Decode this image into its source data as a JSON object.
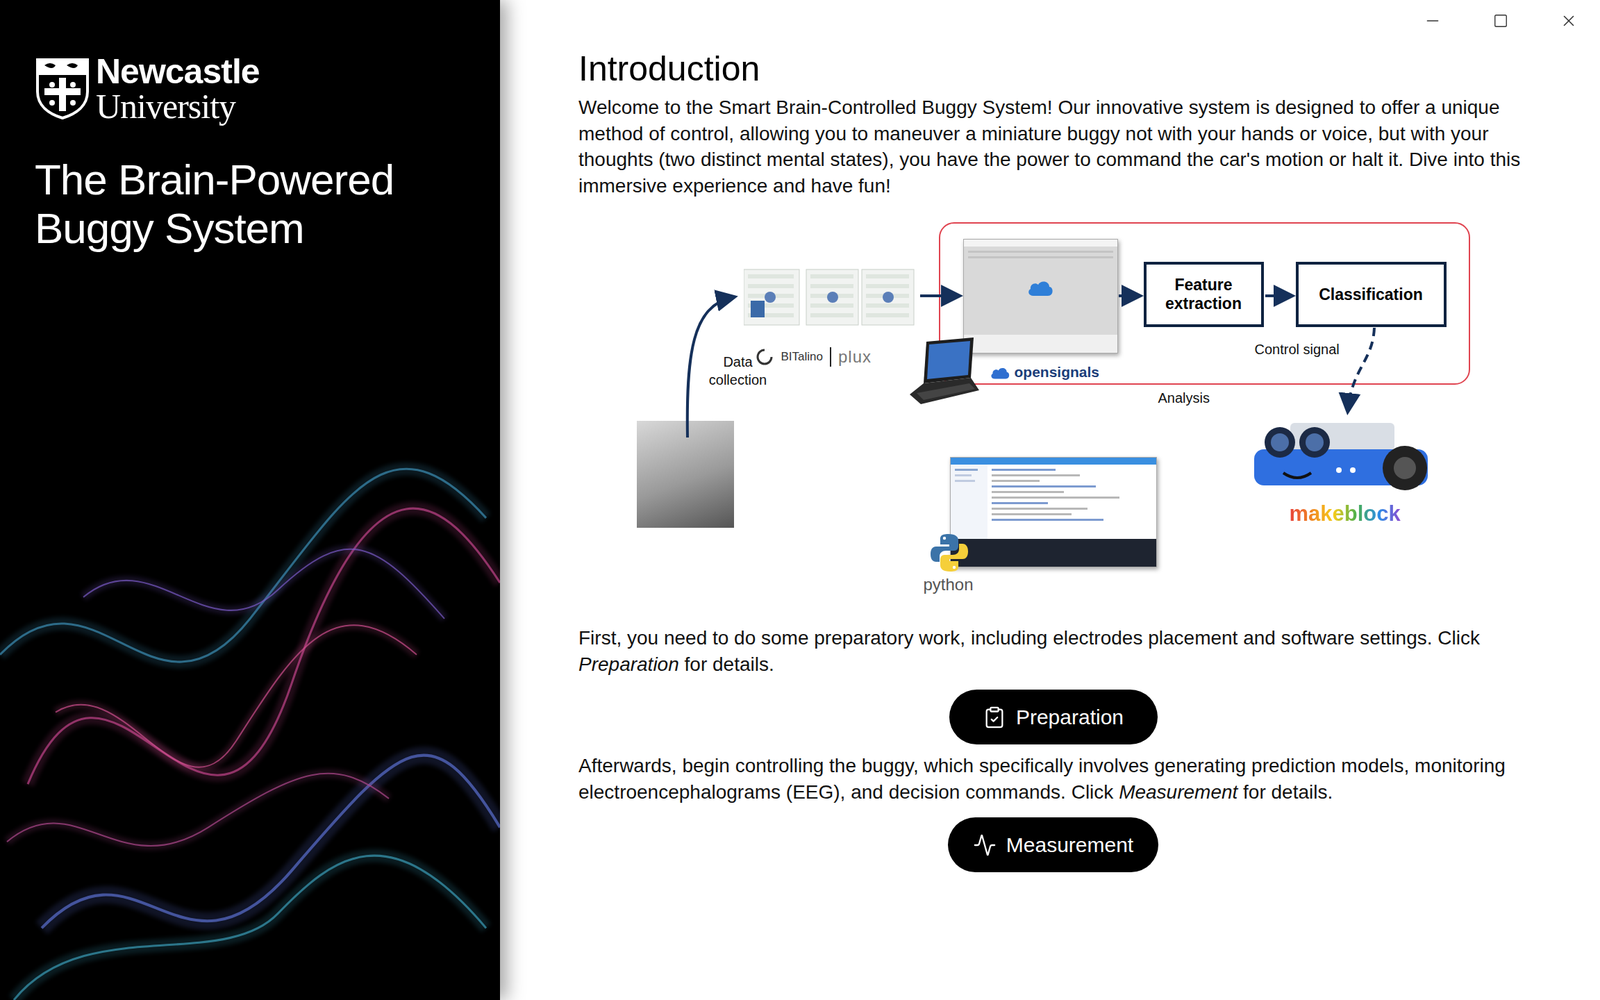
{
  "sidebar": {
    "logo": [
      "Newcastle",
      "University"
    ],
    "title": [
      "The Brain-Powered",
      "Buggy System"
    ]
  },
  "intro": {
    "heading": "Introduction",
    "text": "Welcome to the Smart Brain-Controlled Buggy System! Our innovative system is designed to offer a unique method of control, allowing you to maneuver a miniature buggy not with your hands or voice, but with your thoughts (two distinct mental states), you have the power to command the car's motion or halt it. Dive into this immersive experience and have fun!"
  },
  "diagram": {
    "data_collection": "Data collection",
    "bitalino": "BITalino",
    "plux": "plux",
    "opensignals": "opensignals",
    "feature_extraction": "Feature extraction",
    "classification": "Classification",
    "control_signal": "Control signal",
    "analysis": "Analysis",
    "python": "python",
    "makeblock": "makeblock"
  },
  "sections": [
    {
      "before": "First, you need to do some preparatory work, including electrodes placement and software settings. Click ",
      "emphasis": "Preparation",
      "after": " for details.",
      "button": "Preparation",
      "icon": "clipboard"
    },
    {
      "before": "Afterwards, begin controlling the buggy, which specifically involves generating prediction models, monitoring electroencephalograms (EEG), and decision commands. Click ",
      "emphasis": "Measurement",
      "after": " for details.",
      "button": "Measurement",
      "icon": "pulse"
    }
  ]
}
